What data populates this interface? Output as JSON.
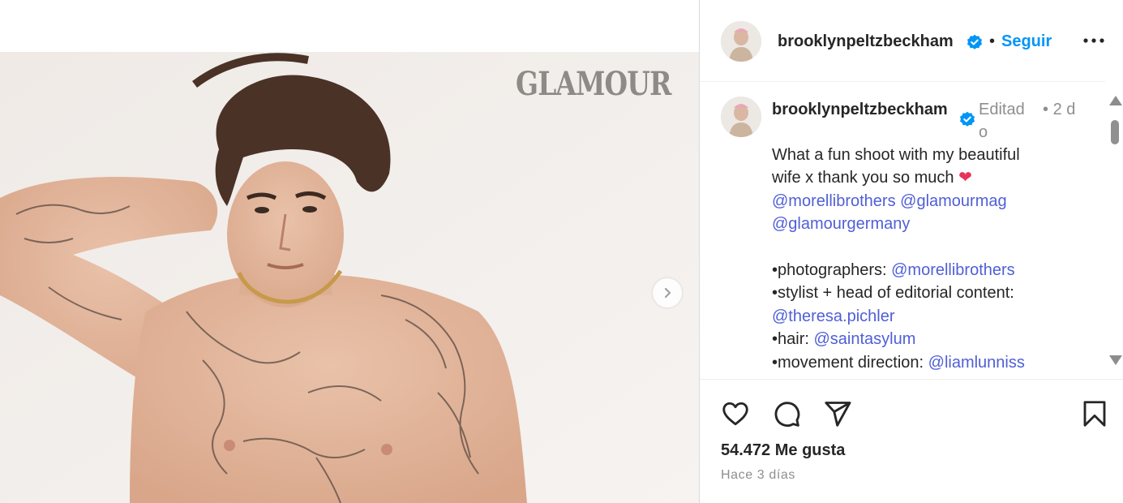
{
  "media": {
    "magazine_logo": "GLAMOUR"
  },
  "header": {
    "username": "brooklynpeltzbeckham",
    "separator": "•",
    "follow_label": "Seguir"
  },
  "caption": {
    "username": "brooklynpeltzbeckham",
    "edited_label": "Editado",
    "separator": "•",
    "age": "2 d",
    "line1": "What a fun shoot with my beautiful",
    "line2_text": "wife x thank you so much ",
    "line2_emoji": "❤",
    "mention1": "@morellibrothers",
    "mention2": "@glamourmag",
    "mention3": "@glamourgermany",
    "photographers_label": "•photographers: ",
    "photographers_mention": "@morellibrothers",
    "stylist_label": "•stylist + head of editorial content:",
    "stylist_mention": "@theresa.pichler",
    "hair_label": "•hair: ",
    "hair_mention": "@saintasylum",
    "movement_label": "•movement direction: ",
    "movement_mention": "@liamlunniss"
  },
  "footer": {
    "likes": "54.472 Me gusta",
    "posted": "Hace 3 días"
  },
  "icons": {
    "like": "heart-outline-icon",
    "comment": "speech-bubble-icon",
    "share": "paper-plane-icon",
    "save": "bookmark-icon",
    "more": "ellipsis-icon",
    "verified": "verified-badge-icon",
    "next": "chevron-right-icon"
  },
  "colors": {
    "link": "#4f5fd6",
    "follow": "#0095f6",
    "verified": "#0095f6",
    "muted": "#8e8e8e",
    "text": "#262626"
  }
}
